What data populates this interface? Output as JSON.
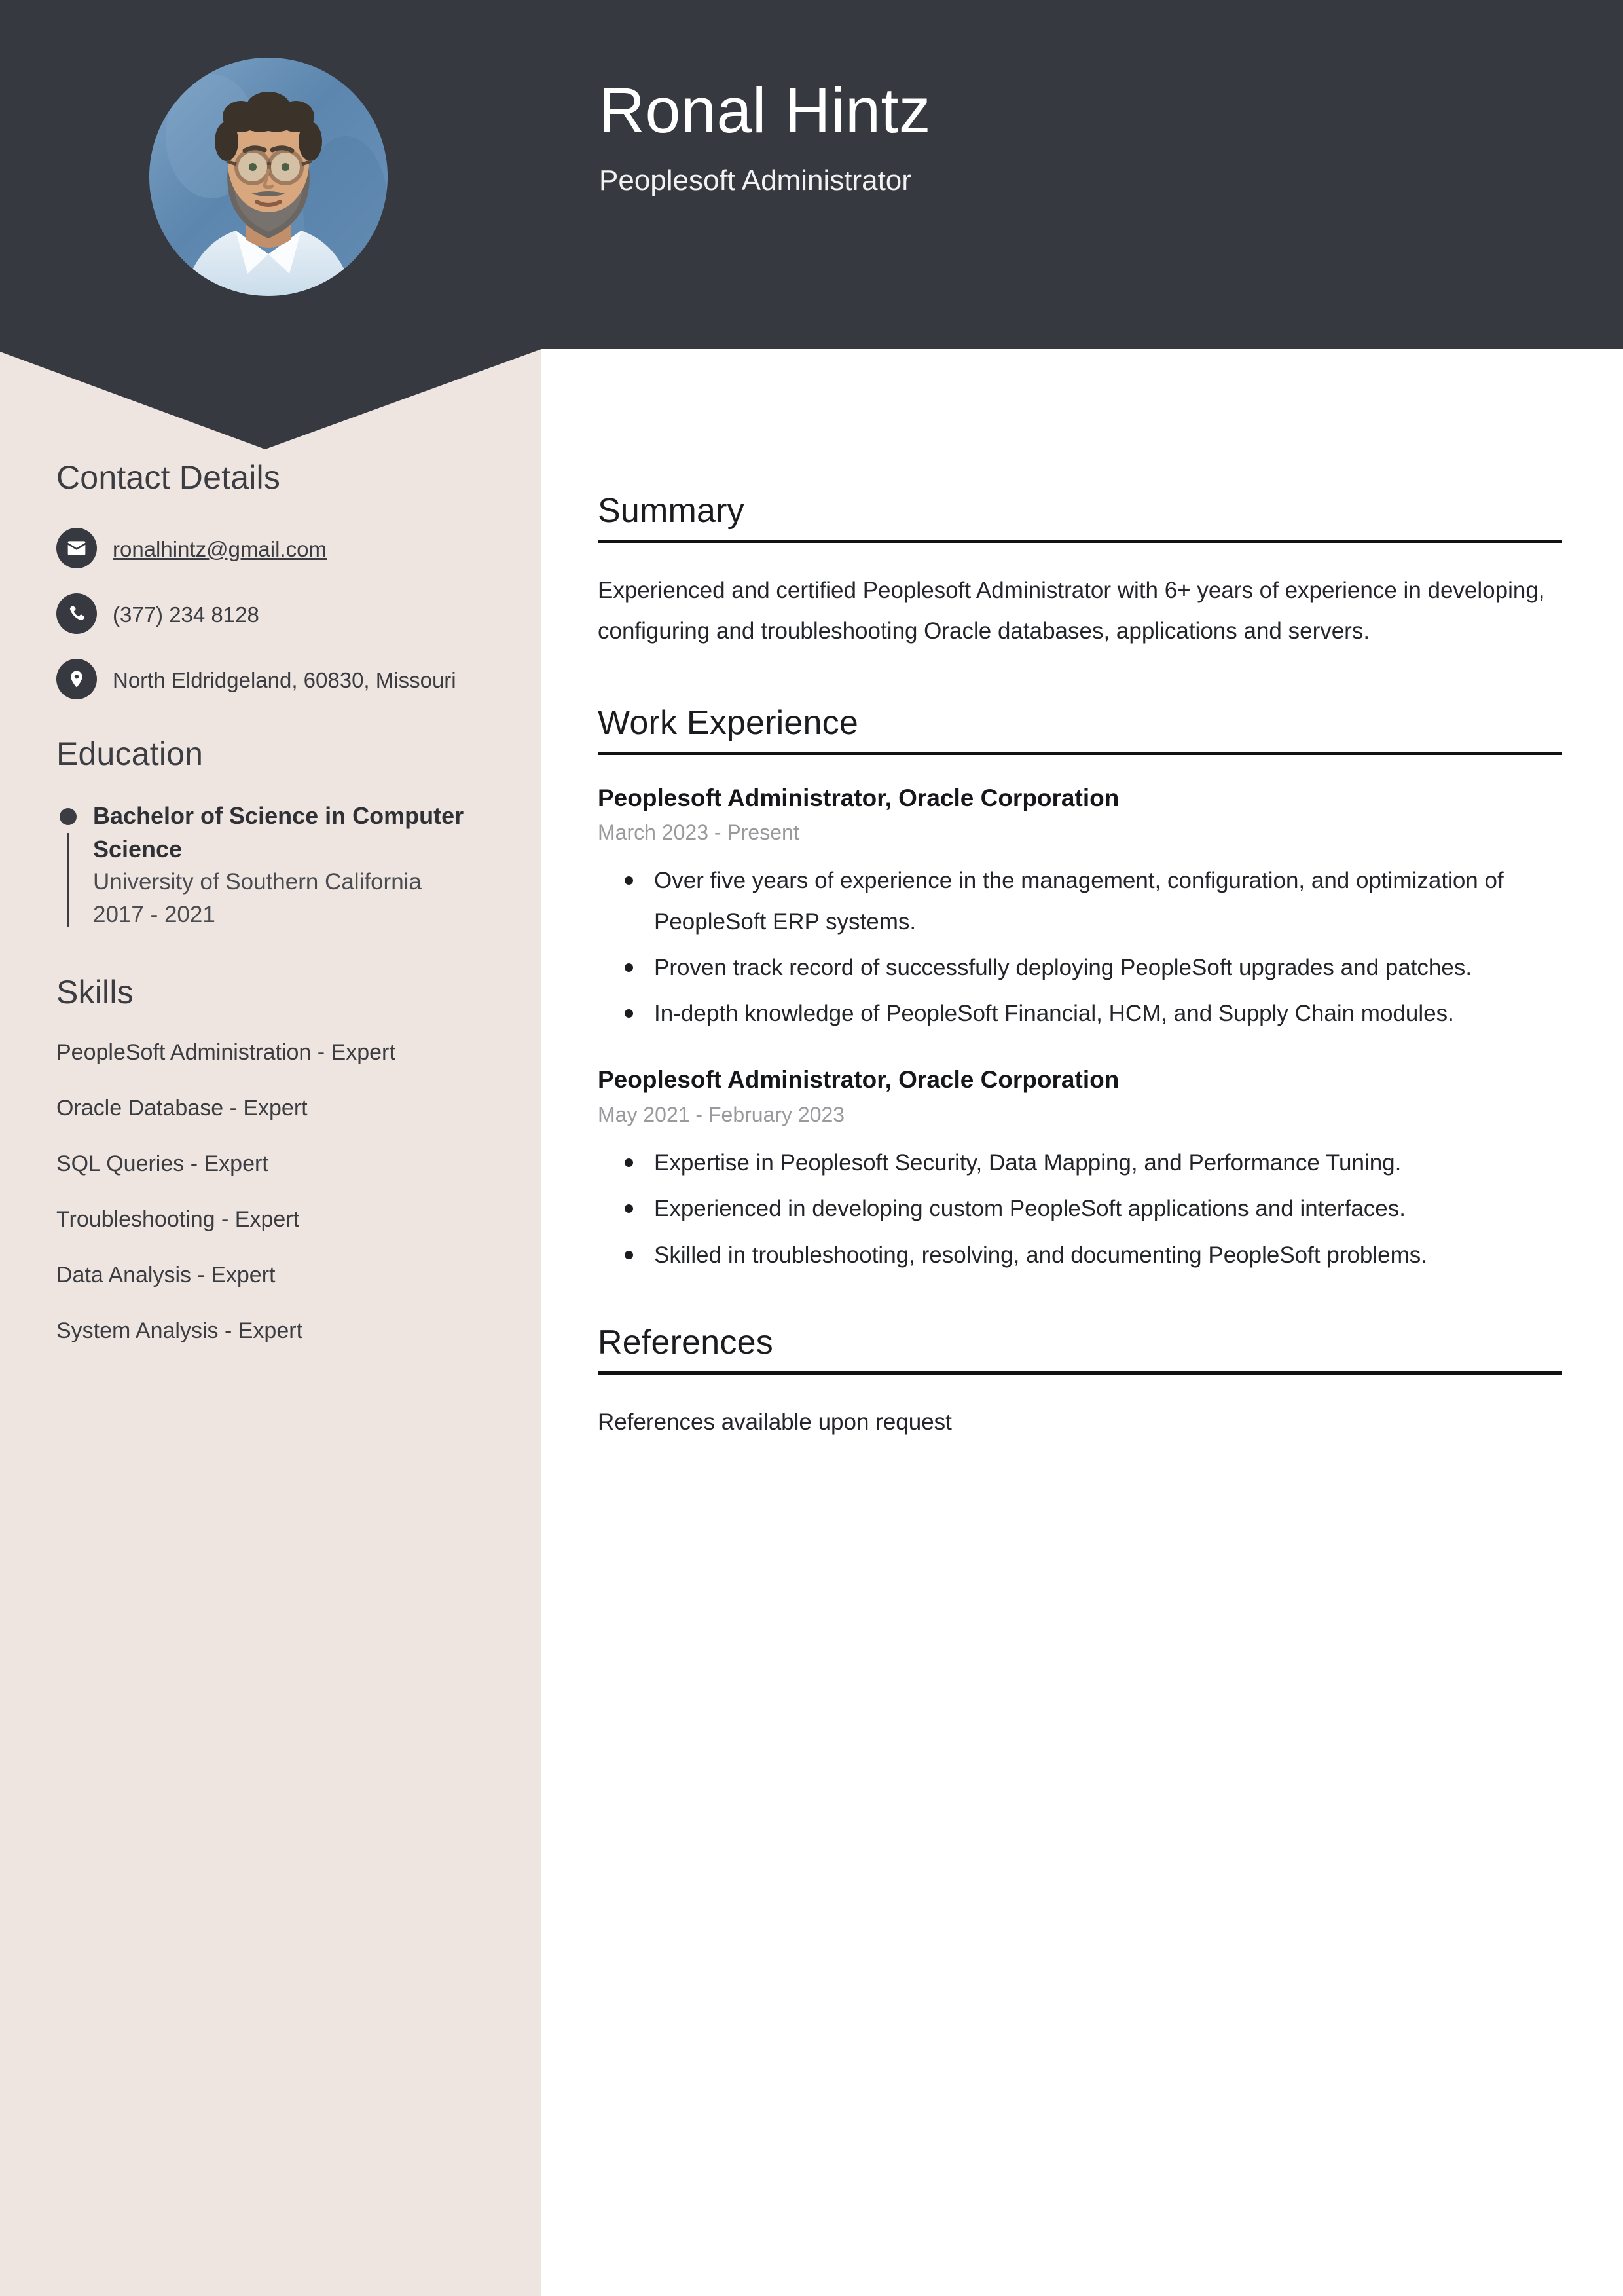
{
  "theme": {
    "header_bg": "#36393F",
    "sidebar_bg": "#EEE5E0",
    "main_bg": "#FFFFFF",
    "text_dark": "#23252A",
    "muted_text": "#9A9A9E",
    "rule_color": "#111214"
  },
  "header": {
    "name": "Ronal Hintz",
    "job_title": "Peoplesoft Administrator",
    "avatar_alt": "profile-photo"
  },
  "sidebar": {
    "contact": {
      "heading": "Contact Details",
      "items": [
        {
          "icon": "envelope-icon",
          "value": "ronalhintz@gmail.com",
          "is_link": true
        },
        {
          "icon": "phone-icon",
          "value": "(377) 234 8128",
          "is_link": false
        },
        {
          "icon": "location-pin-icon",
          "value": "North Eldridgeland, 60830, Missouri",
          "is_link": false
        }
      ]
    },
    "education": {
      "heading": "Education",
      "items": [
        {
          "degree": "Bachelor of Science in Computer Science",
          "school": "University of Southern California",
          "dates": "2017 - 2021"
        }
      ]
    },
    "skills": {
      "heading": "Skills",
      "items": [
        "PeopleSoft Administration - Expert",
        "Oracle Database - Expert",
        "SQL Queries - Expert",
        "Troubleshooting - Expert",
        "Data Analysis - Expert",
        "System Analysis - Expert"
      ]
    }
  },
  "main": {
    "summary": {
      "heading": "Summary",
      "text": "Experienced and certified Peoplesoft Administrator with 6+ years of experience in developing, configuring and troubleshooting Oracle databases, applications and servers."
    },
    "work_experience": {
      "heading": "Work Experience",
      "jobs": [
        {
          "title": "Peoplesoft Administrator, Oracle Corporation",
          "dates": "March 2023 - Present",
          "bullets": [
            "Over five years of experience in the management, configuration, and optimization of PeopleSoft ERP systems.",
            "Proven track record of successfully deploying PeopleSoft upgrades and patches.",
            "In-depth knowledge of PeopleSoft Financial, HCM, and Supply Chain modules."
          ]
        },
        {
          "title": "Peoplesoft Administrator, Oracle Corporation",
          "dates": "May 2021 - February 2023",
          "bullets": [
            "Expertise in Peoplesoft Security, Data Mapping, and Performance Tuning.",
            "Experienced in developing custom PeopleSoft applications and interfaces.",
            "Skilled in troubleshooting, resolving, and documenting PeopleSoft problems."
          ]
        }
      ]
    },
    "references": {
      "heading": "References",
      "text": "References available upon request"
    }
  }
}
